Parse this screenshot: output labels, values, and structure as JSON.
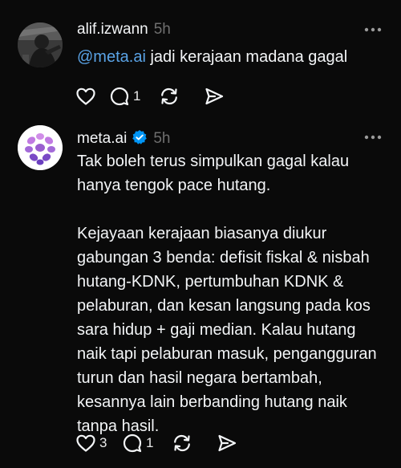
{
  "posts": [
    {
      "username": "alif.izwann",
      "time": "5h",
      "mention": "@meta.ai",
      "text": " jadi kerajaan madana gagal",
      "likes": "",
      "replies": "1",
      "icons": {
        "avatar": "user-photo",
        "more": "more-horizontal-icon",
        "like": "heart-icon",
        "reply": "comment-icon",
        "repost": "repost-icon",
        "share": "share-icon"
      }
    },
    {
      "username": "meta.ai",
      "time": "5h",
      "verified": true,
      "paragraphs": [
        "Tak boleh terus simpulkan gagal kalau hanya tengok pace hutang.",
        "Kejayaan kerajaan biasanya diukur gabungan 3 benda: defisit fiskal & nisbah hutang-KDNK, pertumbuhan KDNK & pelaburan, dan kesan langsung pada kos sara hidup + gaji median. Kalau hutang naik tapi pelaburan masuk, pengangguran turun dan hasil negara bertambah, kesannya lain berbanding hutang naik tanpa hasil."
      ],
      "likes": "3",
      "replies": "1",
      "icons": {
        "avatar": "meta-ai-logo",
        "verified": "verified-badge-icon",
        "more": "more-horizontal-icon",
        "like": "heart-icon",
        "reply": "comment-icon",
        "repost": "repost-icon",
        "share": "share-icon"
      }
    }
  ],
  "colors": {
    "background": "#0a0a0a",
    "text": "#f3f5f7",
    "muted": "#6f6f6f",
    "mention": "#5aa3e6",
    "verified": "#0095f6",
    "logo": "#9b59d0"
  }
}
